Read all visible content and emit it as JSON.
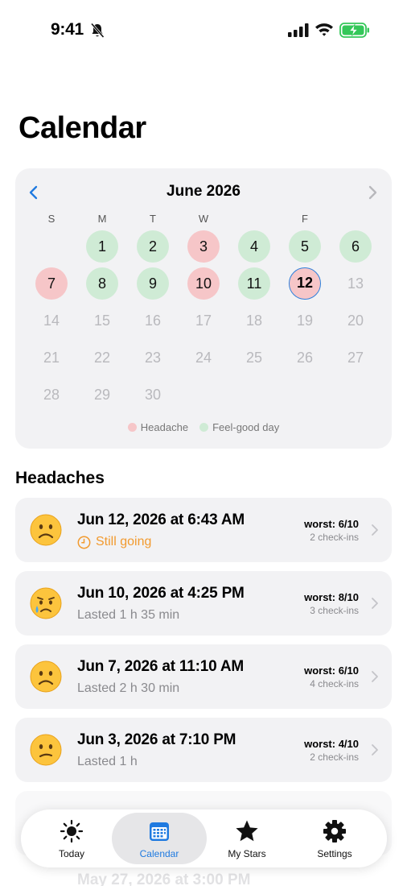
{
  "status": {
    "time": "9:41"
  },
  "page_title": "Calendar",
  "calendar": {
    "month_label": "June 2026",
    "weekday_labels": [
      "S",
      "M",
      "T",
      "W",
      "",
      "F",
      ""
    ],
    "days": [
      {
        "label": "1",
        "state": "feel-good"
      },
      {
        "label": "2",
        "state": "feel-good"
      },
      {
        "label": "3",
        "state": "headache"
      },
      {
        "label": "4",
        "state": "feel-good"
      },
      {
        "label": "5",
        "state": "feel-good"
      },
      {
        "label": "6",
        "state": "feel-good"
      },
      {
        "label": "7",
        "state": "headache"
      },
      {
        "label": "8",
        "state": "feel-good"
      },
      {
        "label": "9",
        "state": "feel-good"
      },
      {
        "label": "10",
        "state": "headache"
      },
      {
        "label": "11",
        "state": "feel-good"
      },
      {
        "label": "12",
        "state": "today-headache"
      },
      {
        "label": "13",
        "state": "future"
      },
      {
        "label": "14",
        "state": "future"
      },
      {
        "label": "15",
        "state": "future"
      },
      {
        "label": "16",
        "state": "future"
      },
      {
        "label": "17",
        "state": "future"
      },
      {
        "label": "18",
        "state": "future"
      },
      {
        "label": "19",
        "state": "future"
      },
      {
        "label": "20",
        "state": "future"
      },
      {
        "label": "21",
        "state": "future"
      },
      {
        "label": "22",
        "state": "future"
      },
      {
        "label": "23",
        "state": "future"
      },
      {
        "label": "24",
        "state": "future"
      },
      {
        "label": "25",
        "state": "future"
      },
      {
        "label": "26",
        "state": "future"
      },
      {
        "label": "27",
        "state": "future"
      },
      {
        "label": "28",
        "state": "future"
      },
      {
        "label": "29",
        "state": "future"
      },
      {
        "label": "30",
        "state": "future"
      }
    ],
    "first_weekday_index": 1,
    "legend": [
      {
        "label": "Headache",
        "color": "#f6c6c8"
      },
      {
        "label": "Feel-good day",
        "color": "#cfebd5"
      }
    ]
  },
  "section_title": "Headaches",
  "headaches": [
    {
      "title": "Jun 12, 2026 at 6:43 AM",
      "subtitle": "Still going",
      "ongoing": true,
      "worst": "worst: 6/10",
      "checkins": "2 check-ins",
      "face": "frowning-face-icon"
    },
    {
      "title": "Jun 10, 2026 at 4:25 PM",
      "subtitle": "Lasted 1 h 35 min",
      "ongoing": false,
      "worst": "worst: 8/10",
      "checkins": "3 check-ins",
      "face": "crying-face-icon"
    },
    {
      "title": "Jun 7, 2026 at 11:10 AM",
      "subtitle": "Lasted 2 h 30 min",
      "ongoing": false,
      "worst": "worst: 6/10",
      "checkins": "4 check-ins",
      "face": "frowning-face-icon"
    },
    {
      "title": "Jun 3, 2026 at 7:10 PM",
      "subtitle": "Lasted 1 h",
      "ongoing": false,
      "worst": "worst: 4/10",
      "checkins": "2 check-ins",
      "face": "confused-face-icon"
    }
  ],
  "faded_entry_title": "May 27, 2026 at 3:00 PM",
  "tabs": [
    {
      "label": "Today",
      "icon": "sun-icon",
      "active": false
    },
    {
      "label": "Calendar",
      "icon": "calendar-icon",
      "active": true
    },
    {
      "label": "My Stars",
      "icon": "star-icon",
      "active": false
    },
    {
      "label": "Settings",
      "icon": "gear-icon",
      "active": false
    }
  ],
  "colors": {
    "accent": "#1f7ae0",
    "headache": "#f6c6c8",
    "feel_good": "#cfebd5",
    "ongoing": "#f29a2e"
  }
}
